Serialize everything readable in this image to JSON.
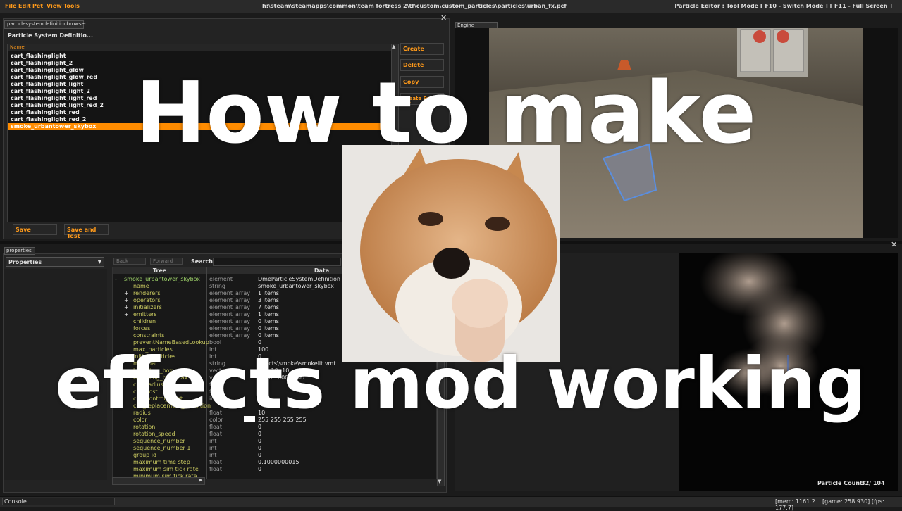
{
  "menubar": {
    "items": [
      "File",
      "Edit",
      "Pet",
      "View",
      "Tools"
    ],
    "path": "h:\\steam\\steamapps\\common\\team fortress 2\\tf\\custom\\custom_particles\\particles\\urban_fx.pcf",
    "mode": "Particle Editor : Tool Mode [ F10 - Switch Mode ] [ F11 - Full Screen ]"
  },
  "browser": {
    "tab": "particlesystemdefinitionbrowser",
    "heading": "Particle System Definitio...",
    "column": "Name",
    "items": [
      "cart_flashinglight",
      "cart_flashinglight_2",
      "cart_flashinglight_glow",
      "cart_flashinglight_glow_red",
      "cart_flashinglight_light",
      "cart_flashinglight_light_2",
      "cart_flashinglight_light_red",
      "cart_flashinglight_light_red_2",
      "cart_flashinglight_red",
      "cart_flashinglight_red_2",
      "smoke_urbantower_skybox"
    ],
    "selected_index": 10,
    "buttons": {
      "create": "Create",
      "delete": "Delete",
      "copy": "Copy",
      "create_kv": "Create From KV"
    },
    "save": "Save",
    "save_test": "Save and Test"
  },
  "viewport": {
    "tab": "Engine Viewport"
  },
  "properties": {
    "tab": "properties",
    "dropdown": "Properties",
    "back": "Back",
    "forward": "Forward",
    "search_label": "Search:",
    "col_tree": "Tree",
    "col_data": "Data",
    "rows": [
      {
        "name": "smoke_urbantower_skybox",
        "type": "element",
        "value": "DmeParticleSystemDefinition 08"
      },
      {
        "name": "name",
        "type": "string",
        "value": "smoke_urbantower_skybox"
      },
      {
        "name": "renderers",
        "type": "element_array",
        "value": "1 items"
      },
      {
        "name": "operators",
        "type": "element_array",
        "value": "3 items"
      },
      {
        "name": "initializers",
        "type": "element_array",
        "value": "7 items"
      },
      {
        "name": "emitters",
        "type": "element_array",
        "value": "1 items"
      },
      {
        "name": "children",
        "type": "element_array",
        "value": "0 items"
      },
      {
        "name": "forces",
        "type": "element_array",
        "value": "0 items"
      },
      {
        "name": "constraints",
        "type": "element_array",
        "value": "0 items"
      },
      {
        "name": "preventNameBasedLookup",
        "type": "bool",
        "value": "0"
      },
      {
        "name": "max_particles",
        "type": "int",
        "value": "100"
      },
      {
        "name": "initial_particles",
        "type": "int",
        "value": "0"
      },
      {
        "name": "material",
        "type": "string",
        "value": "effects\\smoke\\smokelit.vmt"
      },
      {
        "name": "bounding_box_min",
        "type": "vector",
        "value": "-10 -10 -10"
      },
      {
        "name": "bounding_box_max",
        "type": "vector",
        "value": "1000 1000 1000"
      },
      {
        "name": "cull_radius",
        "type": "float",
        "value": ""
      },
      {
        "name": "cull_cost",
        "type": "float",
        "value": ""
      },
      {
        "name": "cull_control_point",
        "type": "int",
        "value": ""
      },
      {
        "name": "cull_replacement_definition",
        "type": "",
        "value": ""
      },
      {
        "name": "radius",
        "type": "float",
        "value": "10"
      },
      {
        "name": "color",
        "type": "color",
        "value": "255 255 255 255"
      },
      {
        "name": "rotation",
        "type": "float",
        "value": "0"
      },
      {
        "name": "rotation_speed",
        "type": "float",
        "value": "0"
      },
      {
        "name": "sequence_number",
        "type": "int",
        "value": "0"
      },
      {
        "name": "sequence_number 1",
        "type": "int",
        "value": "0"
      },
      {
        "name": "group id",
        "type": "int",
        "value": "0"
      },
      {
        "name": "maximum time step",
        "type": "float",
        "value": "0.1000000015"
      },
      {
        "name": "maximum sim tick rate",
        "type": "float",
        "value": "0"
      },
      {
        "name": "minimum sim tick rate",
        "type": "",
        "value": ""
      }
    ]
  },
  "preview": {
    "particle_label": "Particle Count:",
    "particle_value": "32/ 104"
  },
  "statusbar": {
    "console": "Console",
    "stats": "[mem: 1161.2... [game: 258.930] [fps: 177.7]"
  },
  "overlay": {
    "line1": "How to make",
    "line2": "effects mod working"
  },
  "colors": {
    "accent": "#ff9a1a",
    "selection": "#ff8c00",
    "panel": "#232323"
  }
}
